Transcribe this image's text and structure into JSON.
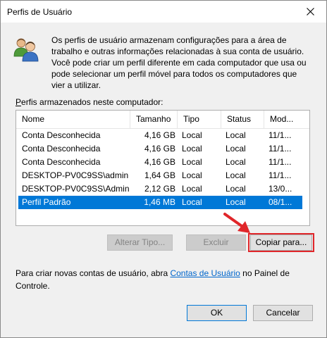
{
  "window": {
    "title": "Perfis de Usuário"
  },
  "description": "Os perfis de usuário armazenam configurações para a área de trabalho e outras informações relacionadas à sua conta de usuário. Você pode criar um perfil diferente em cada computador que usa ou pode selecionar um perfil móvel para todos os computadores que vier a utilizar.",
  "list": {
    "label_prefix": "P",
    "label_rest": "erfis armazenados neste computador:",
    "columns": [
      "Nome",
      "Tamanho",
      "Tipo",
      "Status",
      "Mod..."
    ],
    "rows": [
      [
        "Conta Desconhecida",
        "4,16 GB",
        "Local",
        "Local",
        "11/1..."
      ],
      [
        "Conta Desconhecida",
        "4,16 GB",
        "Local",
        "Local",
        "11/1..."
      ],
      [
        "Conta Desconhecida",
        "4,16 GB",
        "Local",
        "Local",
        "11/1..."
      ],
      [
        "DESKTOP-PV0C9SS\\admin",
        "1,64 GB",
        "Local",
        "Local",
        "11/1..."
      ],
      [
        "DESKTOP-PV0C9SS\\Adminis...",
        "2,12 GB",
        "Local",
        "Local",
        "13/0..."
      ],
      [
        "Perfil Padrão",
        "1,46 MB",
        "Local",
        "Local",
        "08/1..."
      ]
    ],
    "selected_index": 5
  },
  "buttons": {
    "change_type": "Alterar Tipo...",
    "delete": "Excluir",
    "copy_to": "Copiar para...",
    "ok": "OK",
    "cancel": "Cancelar"
  },
  "bottom": {
    "text_before": "Para criar novas contas de usuário, abra ",
    "link": "Contas de Usuário",
    "text_after": " no Painel de Controle."
  },
  "icons": {
    "close": "close-icon",
    "users": "users-icon",
    "annotation": "red-arrow-annotation"
  },
  "colors": {
    "selection": "#0078d7",
    "highlight": "#e0262a",
    "link": "#0066cc"
  }
}
